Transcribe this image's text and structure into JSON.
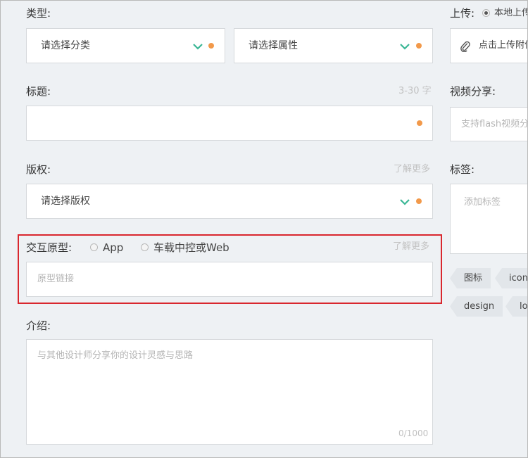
{
  "form": {
    "type_label": "类型:",
    "category_placeholder": "请选择分类",
    "attribute_placeholder": "请选择属性",
    "title_label": "标题:",
    "title_hint": "3-30 字",
    "copyright_label": "版权:",
    "copyright_learn_more": "了解更多",
    "copyright_placeholder": "请选择版权",
    "prototype_label": "交互原型:",
    "prototype_option_app": "App",
    "prototype_option_web": "车载中控或Web",
    "prototype_selected": "none",
    "prototype_learn_more": "了解更多",
    "prototype_link_placeholder": "原型链接",
    "intro_label": "介绍:",
    "intro_placeholder": "与其他设计师分享你的设计灵感与思路",
    "intro_counter": "0/1000"
  },
  "side": {
    "upload_label": "上传:",
    "upload_option_local": "本地上传",
    "upload_button": "点击上传附件",
    "video_label": "视频分享:",
    "video_placeholder": "支持flash视频分享",
    "tags_label": "标签:",
    "tags_placeholder": "添加标签",
    "suggested_tags": [
      "图标",
      "icon",
      "design",
      "logo"
    ]
  },
  "colors": {
    "accent_green": "#3ab795",
    "required_dot": "#f2994a",
    "highlight_border": "#d9272e"
  }
}
